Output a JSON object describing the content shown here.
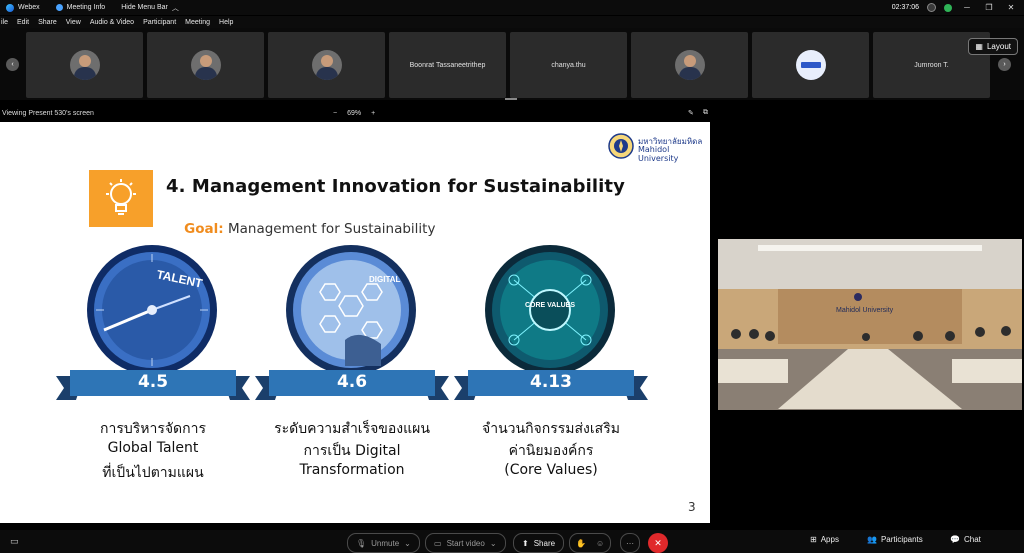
{
  "titlebar": {
    "app": "Webex",
    "meeting_info": "Meeting Info",
    "hide_menu": "Hide Menu Bar",
    "time": "02:37:06"
  },
  "menu": [
    "ile",
    "Edit",
    "Share",
    "View",
    "Audio & Video",
    "Participant",
    "Meeting",
    "Help"
  ],
  "participants": [
    {
      "name": "",
      "kind": "avatar"
    },
    {
      "name": "",
      "kind": "avatar"
    },
    {
      "name": "",
      "kind": "avatar"
    },
    {
      "name": "Boonrat Tassaneetrithep",
      "kind": "name"
    },
    {
      "name": "chanya.thu",
      "kind": "name"
    },
    {
      "name": "",
      "kind": "avatar"
    },
    {
      "name": "",
      "kind": "logo"
    },
    {
      "name": "Jumroon T.",
      "kind": "name"
    }
  ],
  "layout_label": "Layout",
  "viewbar": {
    "viewing": "Viewing Present 530's screen",
    "zoom": "69%"
  },
  "slide": {
    "univ_thai": "มหาวิทยาลัยมหิดล",
    "univ_en": "Mahidol University",
    "title": "4. Management Innovation for Sustainability",
    "goal_label": "Goal:",
    "goal_text": " Management for Sustainability",
    "page": "3",
    "items": [
      {
        "code": "4.5",
        "img_text": "TALENT",
        "lines": [
          "การบริหารจัดการ",
          "Global Talent",
          "ที่เป็นไปตามแผน"
        ]
      },
      {
        "code": "4.6",
        "img_text": "DIGITAL",
        "lines": [
          "ระดับความสำเร็จของแผน",
          "การเป็น Digital",
          "Transformation"
        ]
      },
      {
        "code": "4.13",
        "img_text": "CORE VALUES",
        "lines": [
          "จำนวนกิจกรรมส่งเสริม",
          "ค่านิยมองค์กร",
          "(Core Values)"
        ]
      }
    ]
  },
  "room_sign": "Mahidol University",
  "controls": {
    "unmute": "Unmute",
    "start_video": "Start video",
    "share": "Share",
    "apps": "Apps",
    "participants": "Participants",
    "chat": "Chat"
  },
  "colors": {
    "accent_blue": "#1f6fb4",
    "goal_orange": "#f08c1e",
    "end_red": "#e0292b"
  }
}
